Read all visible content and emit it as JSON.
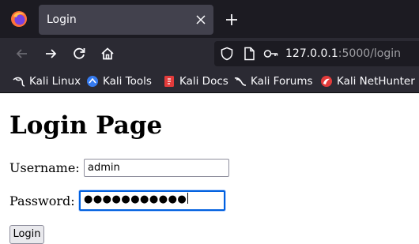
{
  "browser": {
    "tab": {
      "title": "Login"
    },
    "url": {
      "host": "127.0.0.1",
      "rest": ":5000/login"
    },
    "bookmarks": [
      {
        "label": "Kali Linux",
        "icon": "kali-dragon-icon"
      },
      {
        "label": "Kali Tools",
        "icon": "kali-tools-icon"
      },
      {
        "label": "Kali Docs",
        "icon": "kali-docs-icon"
      },
      {
        "label": "Kali Forums",
        "icon": "kali-forums-icon"
      },
      {
        "label": "Kali NetHunter",
        "icon": "kali-nethunter-icon"
      }
    ]
  },
  "page": {
    "heading": "Login Page",
    "username_label": "Username:",
    "username_value": "admin",
    "password_label": "Password:",
    "password_masked": "●●●●●●●●●●●",
    "login_button": "Login"
  },
  "colors": {
    "tabbar_bg": "#1c1b22",
    "toolbar_bg": "#2b2a33",
    "focus_ring": "#0060df"
  }
}
